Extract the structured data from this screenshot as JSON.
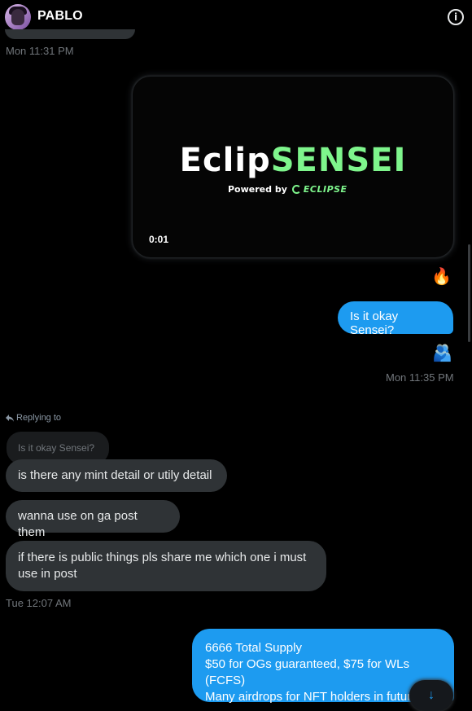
{
  "header": {
    "contact_name": "PABLO"
  },
  "messages": {
    "ts_mon_1131": "Mon 11:31 PM",
    "video_title_white": "Eclip",
    "video_title_green": "SENSEI",
    "video_powered": "Powered by",
    "video_brand": "ECLIPSE",
    "video_duration": "0:01",
    "reaction_1": "🔥",
    "out_1": "Is it okay Sensei?",
    "reaction_2": "🫂",
    "ts_mon_1135": "Mon 11:35 PM",
    "replying_to": "Replying to",
    "quoted_text": "Is it okay Sensei?",
    "in_1": "is there any mint detail or utily detail",
    "in_2": "wanna use on ga post them",
    "in_3": "if there is public things pls share me which one i must use in post",
    "ts_tue_1207": "Tue 12:07 AM",
    "out_2_line1": "6666 Total Supply",
    "out_2_line2": "$50 for OGs guaranteed, $75 for WLs (FCFS)",
    "out_2_line3": "Many airdrops for NFT holders in future"
  },
  "colors": {
    "accent": "#1d9bf0",
    "incoming_bubble": "#2f3336",
    "brand_green": "#7ef58c"
  }
}
